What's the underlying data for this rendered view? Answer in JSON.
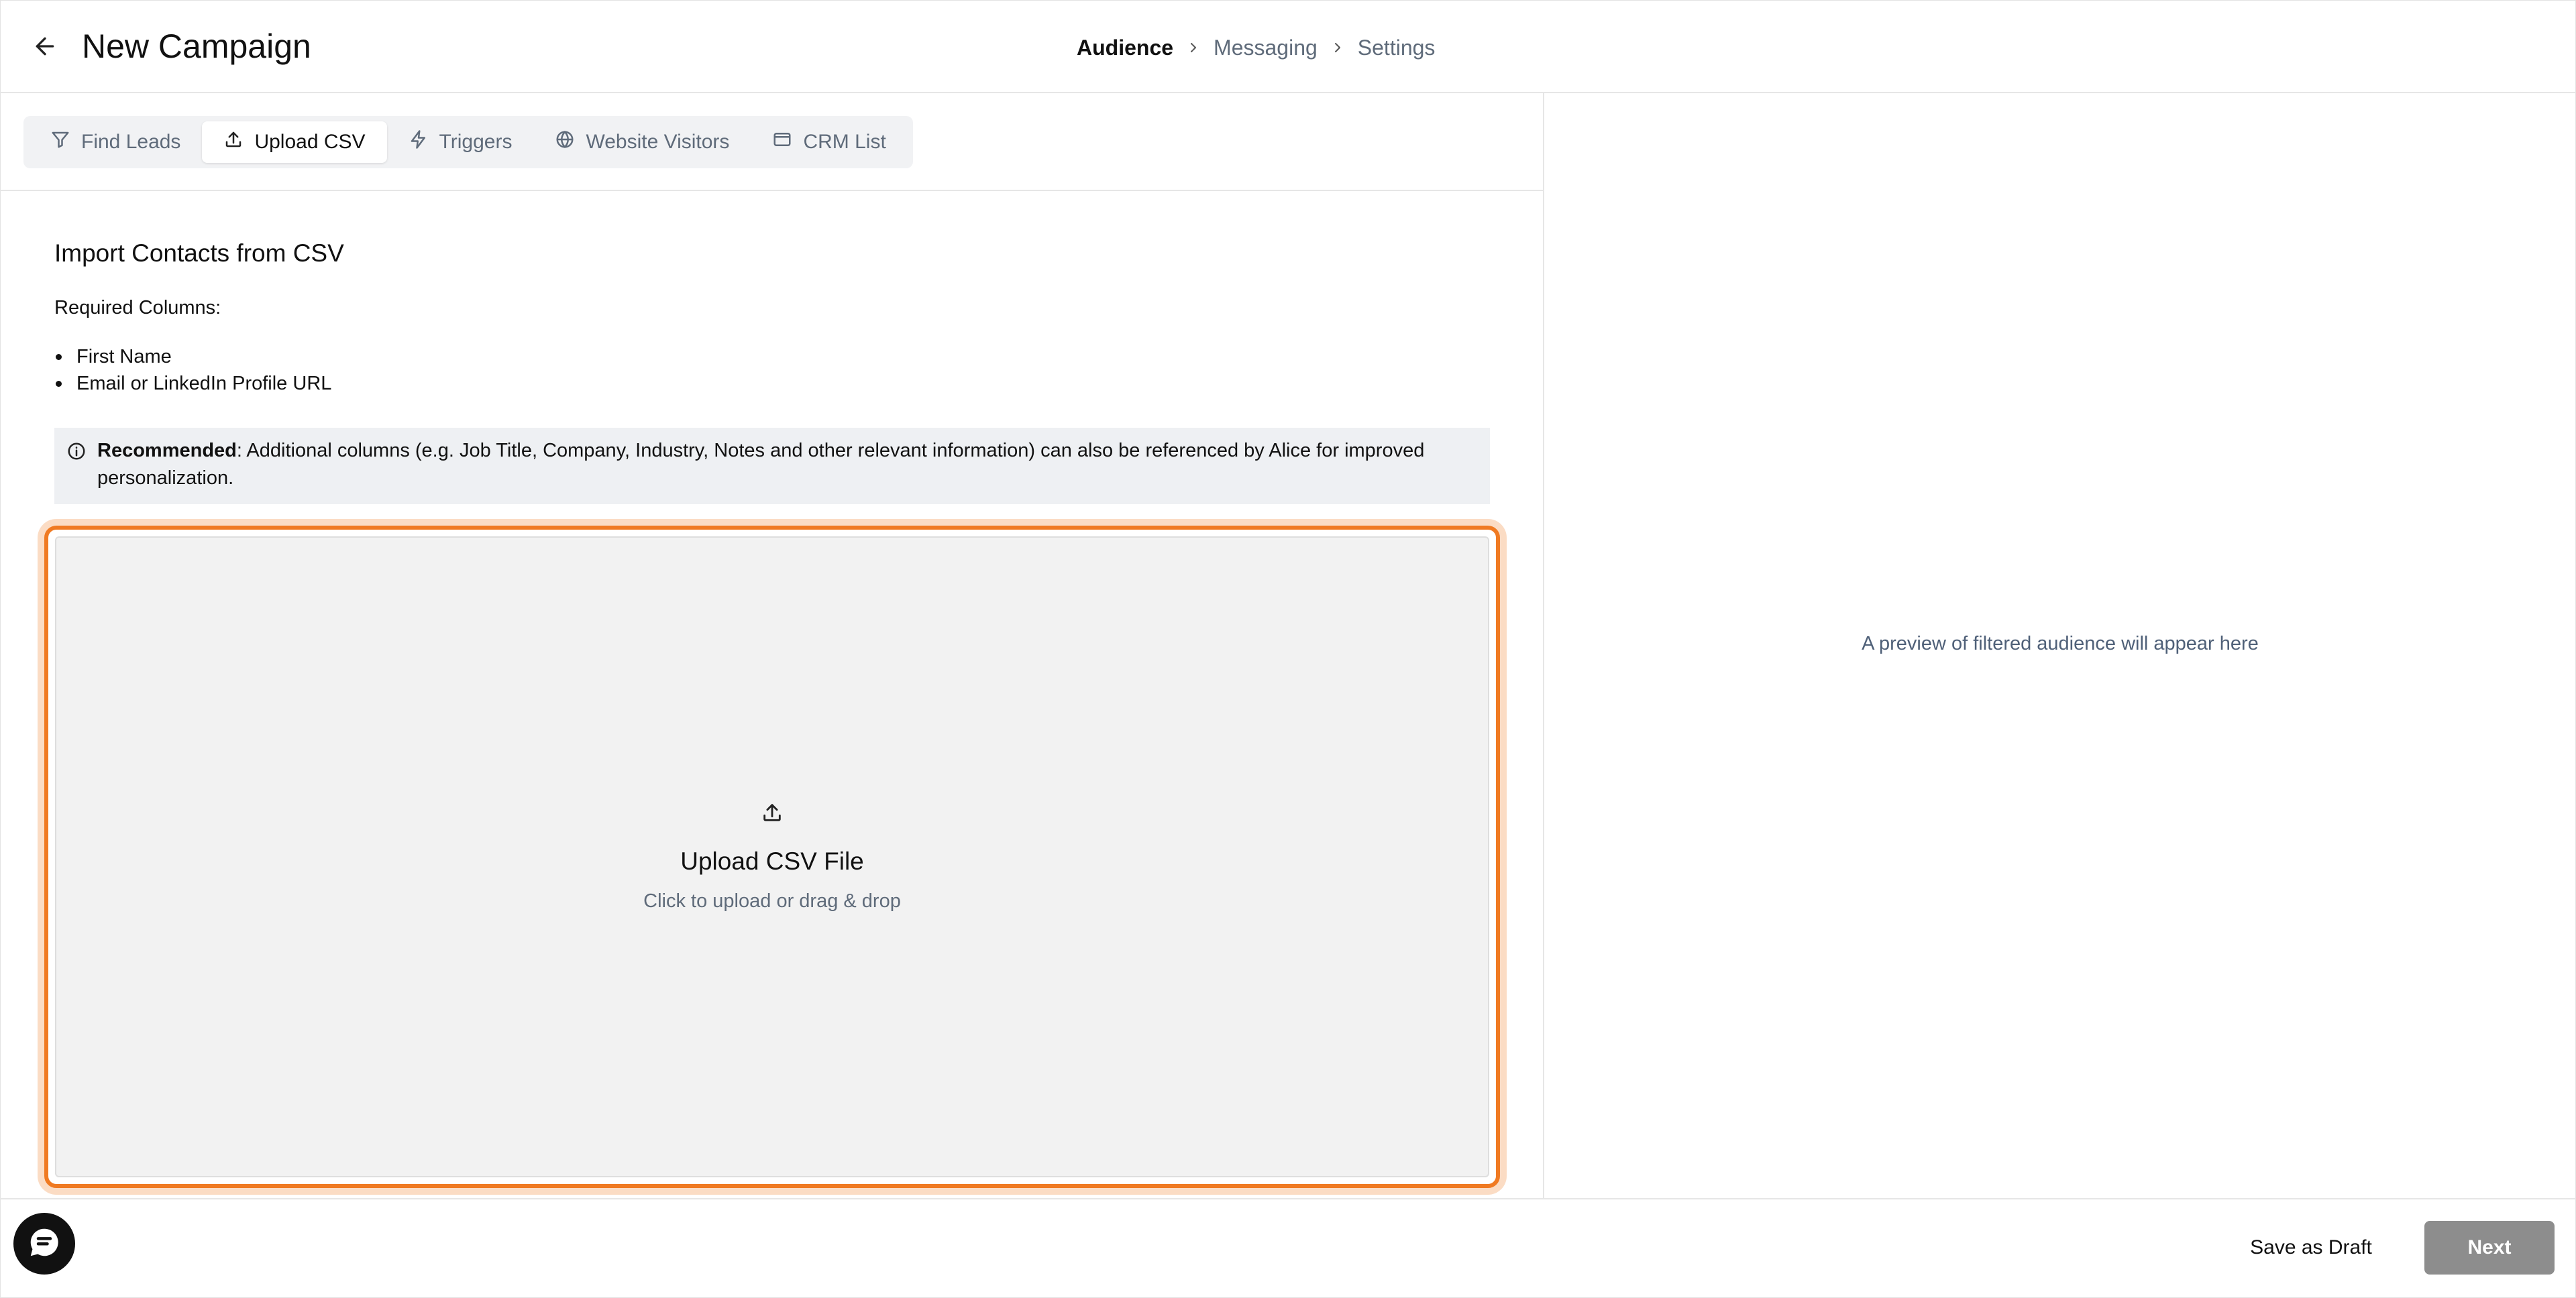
{
  "header": {
    "title": "New Campaign",
    "steps": [
      {
        "label": "Audience"
      },
      {
        "label": "Messaging"
      },
      {
        "label": "Settings"
      }
    ]
  },
  "tabs": [
    {
      "label": "Find Leads",
      "icon": "filter-icon"
    },
    {
      "label": "Upload CSV",
      "icon": "upload-icon"
    },
    {
      "label": "Triggers",
      "icon": "lightning-icon"
    },
    {
      "label": "Website Visitors",
      "icon": "globe-icon"
    },
    {
      "label": "CRM List",
      "icon": "window-icon"
    }
  ],
  "import": {
    "title": "Import Contacts from CSV",
    "required_label": "Required Columns:",
    "required_columns": [
      "First Name",
      "Email or LinkedIn Profile URL"
    ],
    "recommended_label": "Recommended",
    "recommended_text": ": Additional columns (e.g. Job Title, Company, Industry, Notes and other relevant information) can also be referenced by Alice for improved personalization."
  },
  "dropzone": {
    "title": "Upload CSV File",
    "subtitle": "Click to upload or drag & drop"
  },
  "preview": {
    "text": "A preview of filtered audience will appear here"
  },
  "footer": {
    "save_draft_label": "Save as Draft",
    "next_label": "Next"
  },
  "colors": {
    "accent": "#f07a22",
    "next_disabled": "#8d8d8d"
  }
}
